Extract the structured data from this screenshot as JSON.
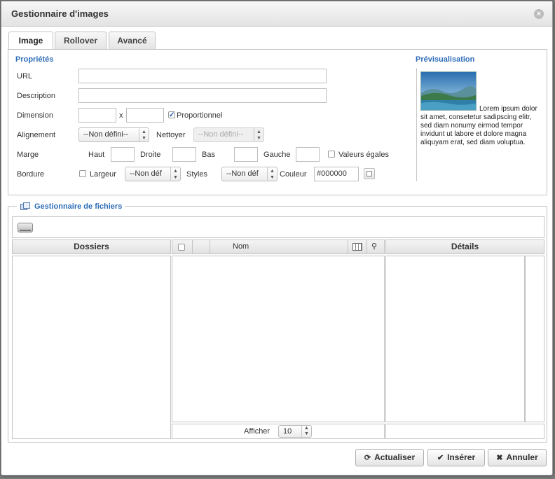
{
  "dialog": {
    "title": "Gestionnaire d'images",
    "close_icon": "close-icon"
  },
  "tabs": [
    {
      "label": "Image",
      "active": true
    },
    {
      "label": "Rollover",
      "active": false
    },
    {
      "label": "Avancé",
      "active": false
    }
  ],
  "properties": {
    "section_title": "Propriétés",
    "url_label": "URL",
    "url_value": "",
    "description_label": "Description",
    "description_value": "",
    "dimension_label": "Dimension",
    "dimension_separator": "x",
    "width_value": "",
    "height_value": "",
    "proportional_label": "Proportionnel",
    "proportional_checked": true,
    "alignment_label": "Alignement",
    "alignment_value": "--Non défini--",
    "clear_label": "Nettoyer",
    "clear_value": "--Non défini--",
    "margin_label": "Marge",
    "margin_top_label": "Haut",
    "margin_right_label": "Droite",
    "margin_bottom_label": "Bas",
    "margin_left_label": "Gauche",
    "equal_values_label": "Valeurs égales",
    "border_label": "Bordure",
    "border_width_label": "Largeur",
    "border_width_value": "--Non déf",
    "border_style_label": "Styles",
    "border_style_value": "--Non déf",
    "border_color_label": "Couleur",
    "border_color_value": "#000000"
  },
  "preview": {
    "title": "Prévisualisation",
    "text": "Lorem ipsum dolor sit amet, consetetur sadipscing elitr, sed diam nonumy eirmod tempor invidunt ut labore et dolore magna aliquyam erat, sed diam voluptua."
  },
  "file_manager": {
    "title": "Gestionnaire de fichiers",
    "folders_header": "Dossiers",
    "name_header": "Nom",
    "details_header": "Détails",
    "show_label": "Afficher",
    "show_value": "10"
  },
  "buttons": {
    "refresh_label": "Actualiser",
    "insert_label": "Insérer",
    "cancel_label": "Annuler"
  }
}
